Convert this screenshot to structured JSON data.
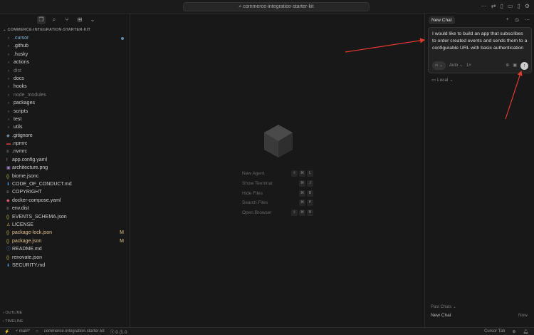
{
  "titlebar": {
    "search": "commerce-integration-starter-kit"
  },
  "explorer": {
    "root": "COMMERCE-INTEGRATION-STARTER-KIT",
    "items": [
      {
        "name": ".cursor",
        "type": "folder",
        "style": "cur",
        "dot": true
      },
      {
        "name": ".github",
        "type": "folder"
      },
      {
        "name": ".husky",
        "type": "folder"
      },
      {
        "name": "actions",
        "type": "folder"
      },
      {
        "name": "dist",
        "type": "folder",
        "style": "dim"
      },
      {
        "name": "docs",
        "type": "folder"
      },
      {
        "name": "hooks",
        "type": "folder"
      },
      {
        "name": "node_modules",
        "type": "folder",
        "style": "dim"
      },
      {
        "name": "packages",
        "type": "folder"
      },
      {
        "name": "scripts",
        "type": "folder"
      },
      {
        "name": "test",
        "type": "folder"
      },
      {
        "name": "utils",
        "type": "folder"
      },
      {
        "name": ".gitignore",
        "icon": "◆",
        "color": "#6a8fa8"
      },
      {
        "name": ".npmrc",
        "icon": "▬",
        "color": "#c0392b"
      },
      {
        "name": ".nvmrc",
        "icon": "≡",
        "color": "#999"
      },
      {
        "name": "app.config.yaml",
        "icon": "!",
        "color": "#c9a"
      },
      {
        "name": "architecture.png",
        "icon": "▣",
        "color": "#a67fd0"
      },
      {
        "name": "biome.jsonc",
        "icon": "{}",
        "color": "#cbb84a"
      },
      {
        "name": "CODE_OF_CONDUCT.md",
        "icon": "⬇",
        "color": "#4a90d9"
      },
      {
        "name": "COPYRIGHT",
        "icon": "≡",
        "color": "#999"
      },
      {
        "name": "docker-compose.yaml",
        "icon": "◆",
        "color": "#e05a6a"
      },
      {
        "name": "env.dist",
        "icon": "≡",
        "color": "#999"
      },
      {
        "name": "EVENTS_SCHEMA.json",
        "icon": "{}",
        "color": "#cbb84a"
      },
      {
        "name": "LICENSE",
        "icon": "♙",
        "color": "#cbb84a"
      },
      {
        "name": "package-lock.json",
        "icon": "{}",
        "color": "#cbb84a",
        "style": "mod",
        "badge": "M"
      },
      {
        "name": "package.json",
        "icon": "{}",
        "color": "#cbb84a",
        "style": "mod",
        "badge": "M"
      },
      {
        "name": "README.md",
        "icon": "ⓘ",
        "color": "#4a90d9"
      },
      {
        "name": "renovate.json",
        "icon": "{}",
        "color": "#cbb84a"
      },
      {
        "name": "SECURITY.md",
        "icon": "⬇",
        "color": "#4a90d9"
      }
    ],
    "outline": "OUTLINE",
    "timeline": "TIMELINE"
  },
  "shortcuts": [
    {
      "label": "New Agent",
      "keys": [
        "⇧",
        "⌘",
        "L"
      ]
    },
    {
      "label": "Show Terminal",
      "keys": [
        "⌘",
        "J"
      ]
    },
    {
      "label": "Hide Files",
      "keys": [
        "⌘",
        "B"
      ]
    },
    {
      "label": "Search Files",
      "keys": [
        "⌘",
        "P"
      ]
    },
    {
      "label": "Open Browser",
      "keys": [
        "⇧",
        "⌘",
        "B"
      ]
    }
  ],
  "chat": {
    "tab": "New Chat",
    "message": "I would like to build an app that subscribes to order created events and sends them to a configurable URL with basic authentication",
    "mode": "∞",
    "model": "Auto ⌄",
    "multiplier": "1×",
    "location": "Local ⌄",
    "past_label": "Past Chats ⌄",
    "past": [
      {
        "title": "New Chat",
        "time": "Now"
      }
    ]
  },
  "status": {
    "branch": "main*",
    "project": "commerce-integration-starter-kit",
    "errors": "ⓧ 0",
    "warnings": "⚠ 0",
    "cursor_tab": "Cursor Tab"
  }
}
